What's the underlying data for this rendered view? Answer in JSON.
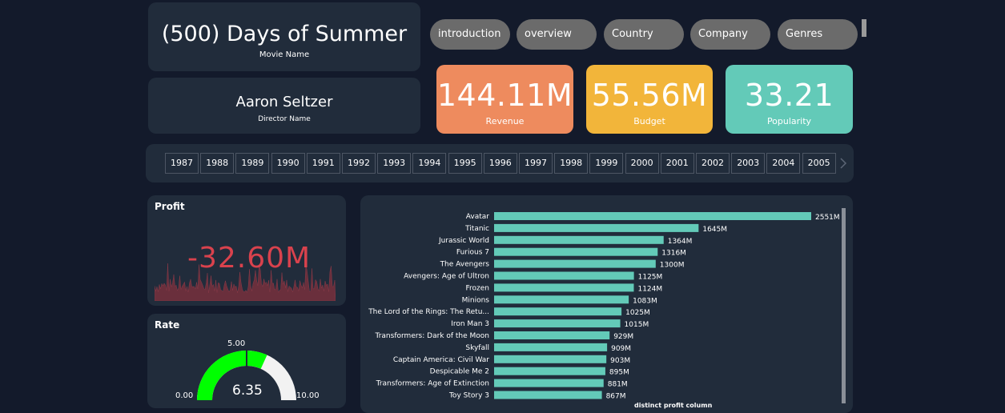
{
  "movie": {
    "name": "(500) Days of Summer",
    "name_label": "Movie Name"
  },
  "director": {
    "name": "Aaron Seltzer",
    "name_label": "Director Name"
  },
  "nav": [
    {
      "label": "introduction"
    },
    {
      "label": "overview"
    },
    {
      "label": "Country"
    },
    {
      "label": "Company"
    },
    {
      "label": "Genres"
    }
  ],
  "kpis": {
    "revenue": {
      "value": "144.11M",
      "label": "Revenue",
      "color": "#ee8b5e"
    },
    "budget": {
      "value": "55.56M",
      "label": "Budget",
      "color": "#f2b53a"
    },
    "popularity": {
      "value": "33.21",
      "label": "Popularity",
      "color": "#63cab8"
    }
  },
  "years": [
    "1987",
    "1988",
    "1989",
    "1990",
    "1991",
    "1992",
    "1993",
    "1994",
    "1995",
    "1996",
    "1997",
    "1998",
    "1999",
    "2000",
    "2001",
    "2002",
    "2003",
    "2004",
    "2005"
  ],
  "profit": {
    "title": "Profit",
    "value": "-32.60M",
    "value_color": "#d9424d"
  },
  "rate": {
    "title": "Rate",
    "value": "6.35",
    "min_label": "0.00",
    "max_label": "10.00",
    "target_label": "5.00",
    "min": 0,
    "max": 10,
    "target": 5,
    "current": 6.35,
    "fill_color": "#00ff00",
    "track_color": "#f2f2f2"
  },
  "chart_data": {
    "type": "bar",
    "orientation": "horizontal",
    "xlabel": "distinct profit column",
    "bar_color": "#63cab8",
    "categories": [
      "Avatar",
      "Titanic",
      "Jurassic World",
      "Furious 7",
      "The Avengers",
      "Avengers: Age of Ultron",
      "Frozen",
      "Minions",
      "The Lord of the Rings: The Retu...",
      "Iron Man 3",
      "Transformers: Dark of the Moon",
      "Skyfall",
      "Captain America: Civil War",
      "Despicable Me 2",
      "Transformers: Age of Extinction",
      "Toy Story 3"
    ],
    "values": [
      2551,
      1645,
      1364,
      1316,
      1300,
      1125,
      1124,
      1083,
      1025,
      1015,
      929,
      909,
      903,
      895,
      881,
      867
    ],
    "value_labels": [
      "2551M",
      "1645M",
      "1364M",
      "1316M",
      "1300M",
      "1125M",
      "1124M",
      "1083M",
      "1025M",
      "1015M",
      "929M",
      "909M",
      "903M",
      "895M",
      "881M",
      "867M"
    ]
  }
}
